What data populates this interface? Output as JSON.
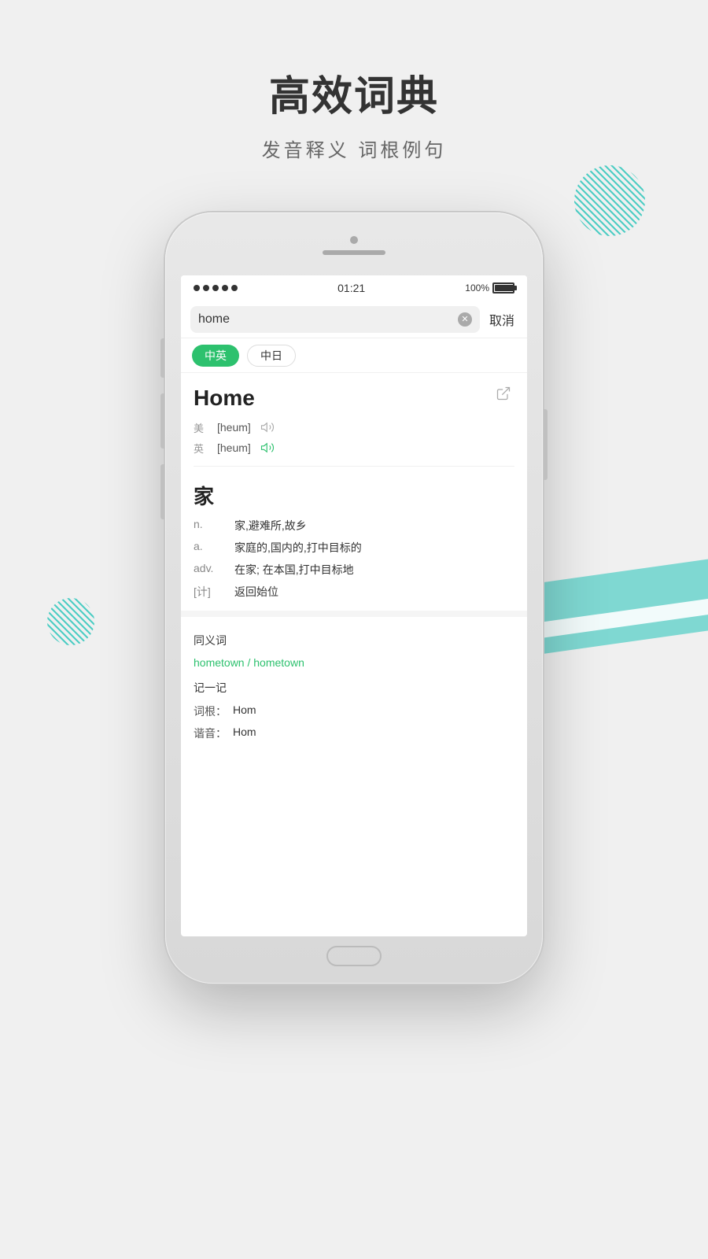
{
  "page": {
    "title": "高效词典",
    "subtitle": "发音释义  词根例句"
  },
  "status_bar": {
    "dots": 5,
    "time": "01:21",
    "battery_pct": "100%"
  },
  "search": {
    "query": "home",
    "cancel_label": "取消"
  },
  "tabs": [
    {
      "label": "中英",
      "active": true
    },
    {
      "label": "中日",
      "active": false
    }
  ],
  "word": {
    "title": "Home",
    "pron_us_label": "美",
    "pron_us": "[heum]",
    "pron_uk_label": "英",
    "pron_uk": "[heum]",
    "chinese_char": "家",
    "definitions": [
      {
        "type": "n.",
        "text": "家,避难所,故乡"
      },
      {
        "type": "a.",
        "text": "家庭的,国内的,打中目标的"
      },
      {
        "type": "adv.",
        "text": "在家; 在本国,打中目标地"
      },
      {
        "type": "[计]",
        "text": "返回始位"
      }
    ],
    "synonyms_header": "同义词",
    "synonyms": "hometown / hometown",
    "memory_header": "记一记",
    "word_root_label": "词根：",
    "word_root": "Hom",
    "phonetic_label": "谐音：",
    "phonetic": "Hom"
  },
  "colors": {
    "green": "#2dc16e",
    "teal": "#4ecdc4"
  }
}
